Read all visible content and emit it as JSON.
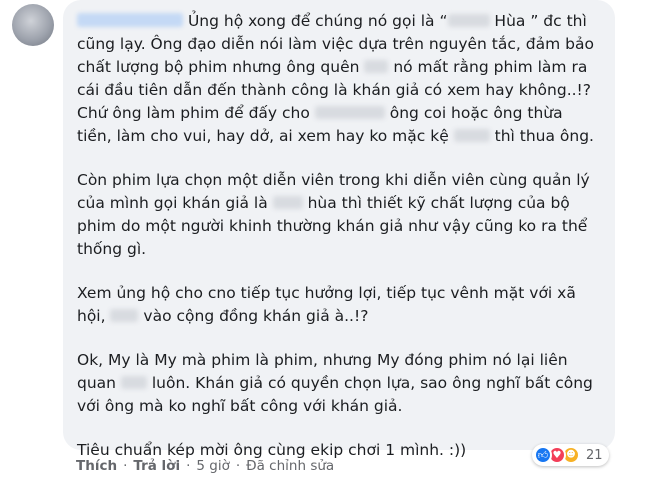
{
  "comment": {
    "paragraphs": [
      {
        "s1": "Ủng hộ xong để chúng nó gọi là “",
        "s2": " Hùa ” đc thì cũng lạy. Ông đạo diễn nói làm việc dựa trên nguyên tắc, đảm bảo chất lượng bộ phim nhưng ông quên",
        "s3": "nó mất rằng phim làm ra cái đầu tiên dẫn đến thành công là khán giả có xem hay không..!? Chứ ông làm phim để đấy cho",
        "s4": "ông coi hoặc ông thừa tiền, làm cho vui, hay dở, ai xem hay ko mặc kệ",
        "s5": "thì thua ông."
      },
      {
        "s1": "Còn phim lựa chọn một diễn viên trong khi diễn viên cùng quản lý của mình gọi khán giả là",
        "s2": "hùa thì thiết kỹ chất lượng của bộ phim do một người khinh thường khán giả như vậy cũng ko ra thể thống gì."
      },
      {
        "s1": "Xem ủng hộ cho cno tiếp tục hưởng lợi, tiếp tục vênh mặt với xã hội,",
        "s2": "vào cộng đồng khán giả à..!?"
      },
      {
        "s1": "Ok, My là My mà phim là phim, nhưng My đóng phim nó lại liên quan",
        "s2": "luôn. Khán giả có quyền chọn lựa, sao ông nghĩ bất công với ông mà ko nghĩ bất công với khán giả."
      },
      {
        "s1": "Tiêu chuẩn kép mời ông cùng ekip chơi 1 mình. :))"
      }
    ]
  },
  "reactions": {
    "icons": [
      "like-icon",
      "love-icon",
      "haha-icon"
    ],
    "count": "21"
  },
  "actions": {
    "like": "Thích",
    "reply": "Trả lời",
    "time": "5 giờ",
    "edited": "Đã chỉnh sửa",
    "separator": "·"
  }
}
